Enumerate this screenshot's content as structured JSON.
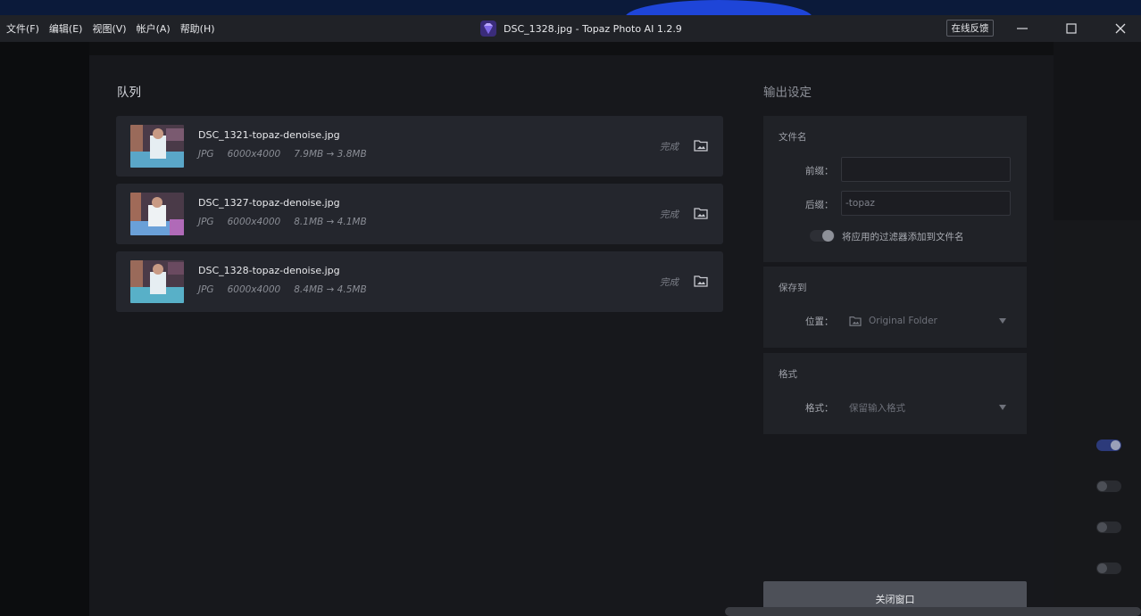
{
  "menu": [
    "文件(F)",
    "编辑(E)",
    "视图(V)",
    "帐户(A)",
    "帮助(H)"
  ],
  "window_title": "DSC_1328.jpg - Topaz Photo AI 1.2.9",
  "feedback_label": "在线反馈",
  "queue": {
    "title": "队列",
    "items": [
      {
        "name": "DSC_1321-topaz-denoise.jpg",
        "format": "JPG",
        "dimensions": "6000x4000",
        "size": "7.9MB → 3.8MB",
        "status": "完成"
      },
      {
        "name": "DSC_1327-topaz-denoise.jpg",
        "format": "JPG",
        "dimensions": "6000x4000",
        "size": "8.1MB → 4.1MB",
        "status": "完成"
      },
      {
        "name": "DSC_1328-topaz-denoise.jpg",
        "format": "JPG",
        "dimensions": "6000x4000",
        "size": "8.4MB → 4.5MB",
        "status": "完成"
      }
    ]
  },
  "output": {
    "title": "输出设定",
    "filename": {
      "label": "文件名",
      "prefix_label": "前缀：",
      "prefix_value": "",
      "suffix_label": "后缀：",
      "suffix_value": "-topaz",
      "toggle_label": "将应用的过滤器添加到文件名"
    },
    "save": {
      "label": "保存到",
      "location_label": "位置：",
      "location_value": "Original Folder"
    },
    "format": {
      "label": "格式",
      "format_label": "格式：",
      "format_value": "保留输入格式"
    }
  },
  "close_button": "关闭窗口",
  "colors": {
    "accent": "#3b5ccc",
    "panel": "#24262d",
    "modal": "#17181c"
  }
}
